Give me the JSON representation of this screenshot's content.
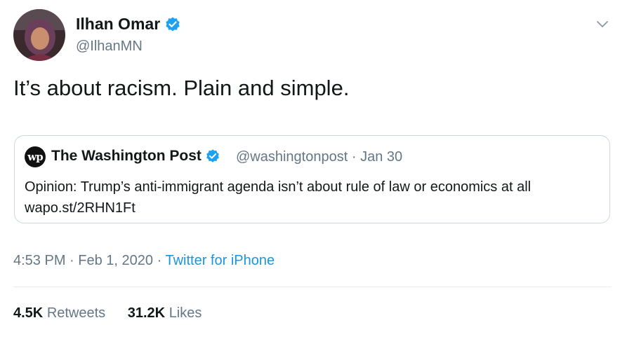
{
  "author": {
    "name": "Ilhan Omar",
    "handle": "@IlhanMN",
    "verified": true
  },
  "tweet": {
    "text": "It’s about racism. Plain and simple."
  },
  "quoted_tweet": {
    "logo_text": "wp",
    "name": "The Washington Post",
    "verified": true,
    "handle": "@washingtonpost",
    "separator": "·",
    "date": "Jan 30",
    "text_line1": "Opinion: Trump’s anti-immigrant agenda isn’t about rule of law or economics at all",
    "text_line2": "wapo.st/2RHN1Ft"
  },
  "meta": {
    "time": "4:53 PM",
    "sep1": "·",
    "date": "Feb 1, 2020",
    "sep2": "·",
    "source": "Twitter for iPhone"
  },
  "stats": {
    "retweets_count": "4.5K",
    "retweets_label": "Retweets",
    "likes_count": "31.2K",
    "likes_label": "Likes"
  },
  "colors": {
    "text": "#14171a",
    "secondary": "#657786",
    "link": "#1b95e0",
    "verified": "#1da1f2",
    "border": "#ccd6dd"
  },
  "icons": {
    "verified": "verified-badge-icon",
    "caret": "chevron-down-icon",
    "publisher_logo": "washington-post-logo"
  }
}
